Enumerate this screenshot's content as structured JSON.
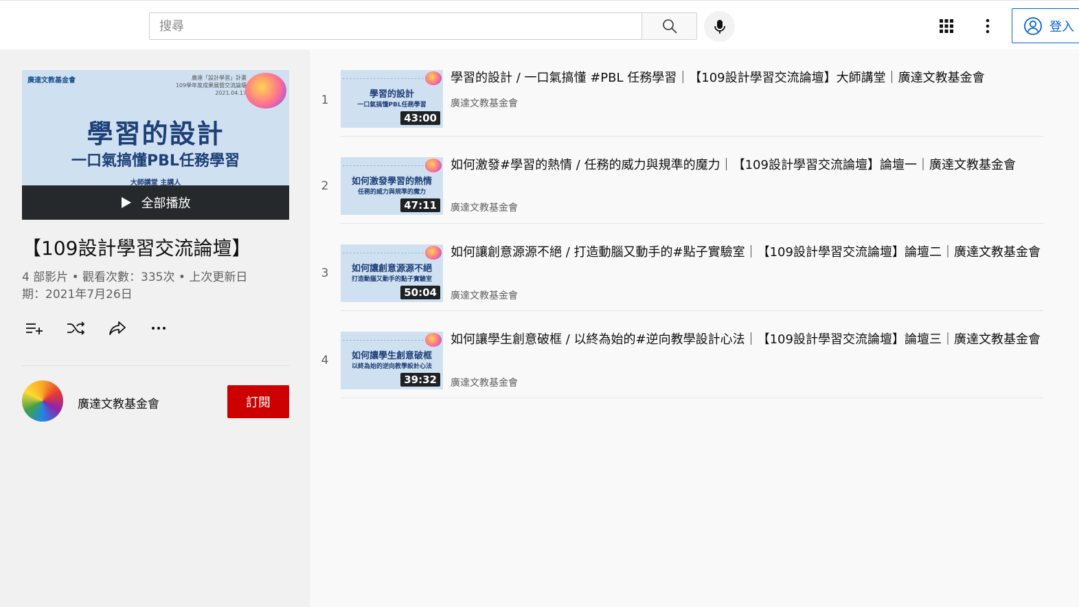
{
  "header": {
    "search_placeholder": "搜尋",
    "signin_label": "登入"
  },
  "playlist": {
    "hero": {
      "org": "廣達文教基金會",
      "meta_line1": "廣達「設計學習」計畫",
      "meta_line2": "109學年度成果展暨交流論壇",
      "meta_line3": "2021.04.17",
      "title": "學習的設計",
      "subtitle": "一口氣搞懂PBL任務學習",
      "speaker": "大師講堂 主講人"
    },
    "play_all_label": "全部播放",
    "title": "【109設計學習交流論壇】",
    "stats": "4 部影片 • 觀看次數：335次 • 上次更新日期：2021年7月26日",
    "owner": "廣達文教基金會",
    "subscribe_label": "訂閱"
  },
  "videos": [
    {
      "index": "1",
      "title": "學習的設計 / 一口氣搞懂 #PBL 任務學習｜【109設計學習交流論壇】大師講堂｜廣達文教基金會",
      "channel": "廣達文教基金會",
      "duration": "43:00",
      "thumb_title": "學習的設計",
      "thumb_sub": "一口氣搞懂PBL任務學習"
    },
    {
      "index": "2",
      "title": "如何激發#學習的熱情 / 任務的威力與規準的魔力｜【109設計學習交流論壇】論壇一｜廣達文教基金會",
      "channel": "廣達文教基金會",
      "duration": "47:11",
      "thumb_title": "如何激發學習的熱情",
      "thumb_sub": "任務的威力與規準的魔力"
    },
    {
      "index": "3",
      "title": "如何讓創意源源不絕 / 打造動腦又動手的#點子實驗室｜【109設計學習交流論壇】論壇二｜廣達文教基金會",
      "channel": "廣達文教基金會",
      "duration": "50:04",
      "thumb_title": "如何讓創意源源不絕",
      "thumb_sub": "打造動腦又動手的點子實驗室"
    },
    {
      "index": "4",
      "title": "如何讓學生創意破框 / 以終為始的#逆向教學設計心法｜【109設計學習交流論壇】論壇三｜廣達文教基金會",
      "channel": "廣達文教基金會",
      "duration": "39:32",
      "thumb_title": "如何讓學生創意破框",
      "thumb_sub": "以終為始的逆向教學設計心法"
    }
  ],
  "colors": {
    "accent_blue": "#065fd4",
    "subscribe_red": "#cc0000"
  },
  "icons": [
    "search-icon",
    "mic-icon",
    "apps-icon",
    "more-vert-icon",
    "account-icon",
    "play-icon",
    "add-to-queue-icon",
    "shuffle-icon",
    "share-icon",
    "more-horiz-icon"
  ]
}
